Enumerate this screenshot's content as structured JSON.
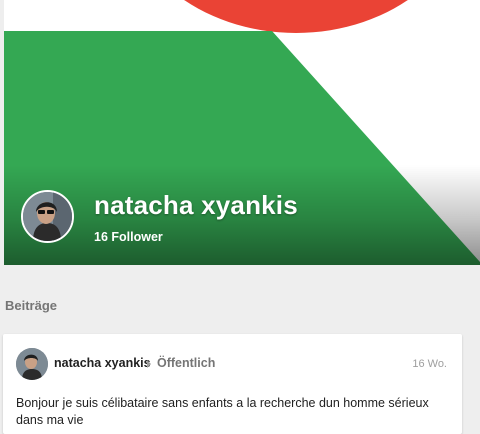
{
  "cover": {
    "colors": {
      "green": "#34a853",
      "red": "#ea4335",
      "light": "#ffffff"
    }
  },
  "profile": {
    "name": "natacha xyankis",
    "followers": "16 Follower",
    "avatar_icon": "profile-photo"
  },
  "section": {
    "title": "Beiträge"
  },
  "post": {
    "author": "natacha xyankis",
    "visibility": "Öffentlich",
    "time": "16 Wo.",
    "text": "Bonjour je suis célibataire sans enfants a la recherche dun homme sérieux dans ma vie"
  }
}
